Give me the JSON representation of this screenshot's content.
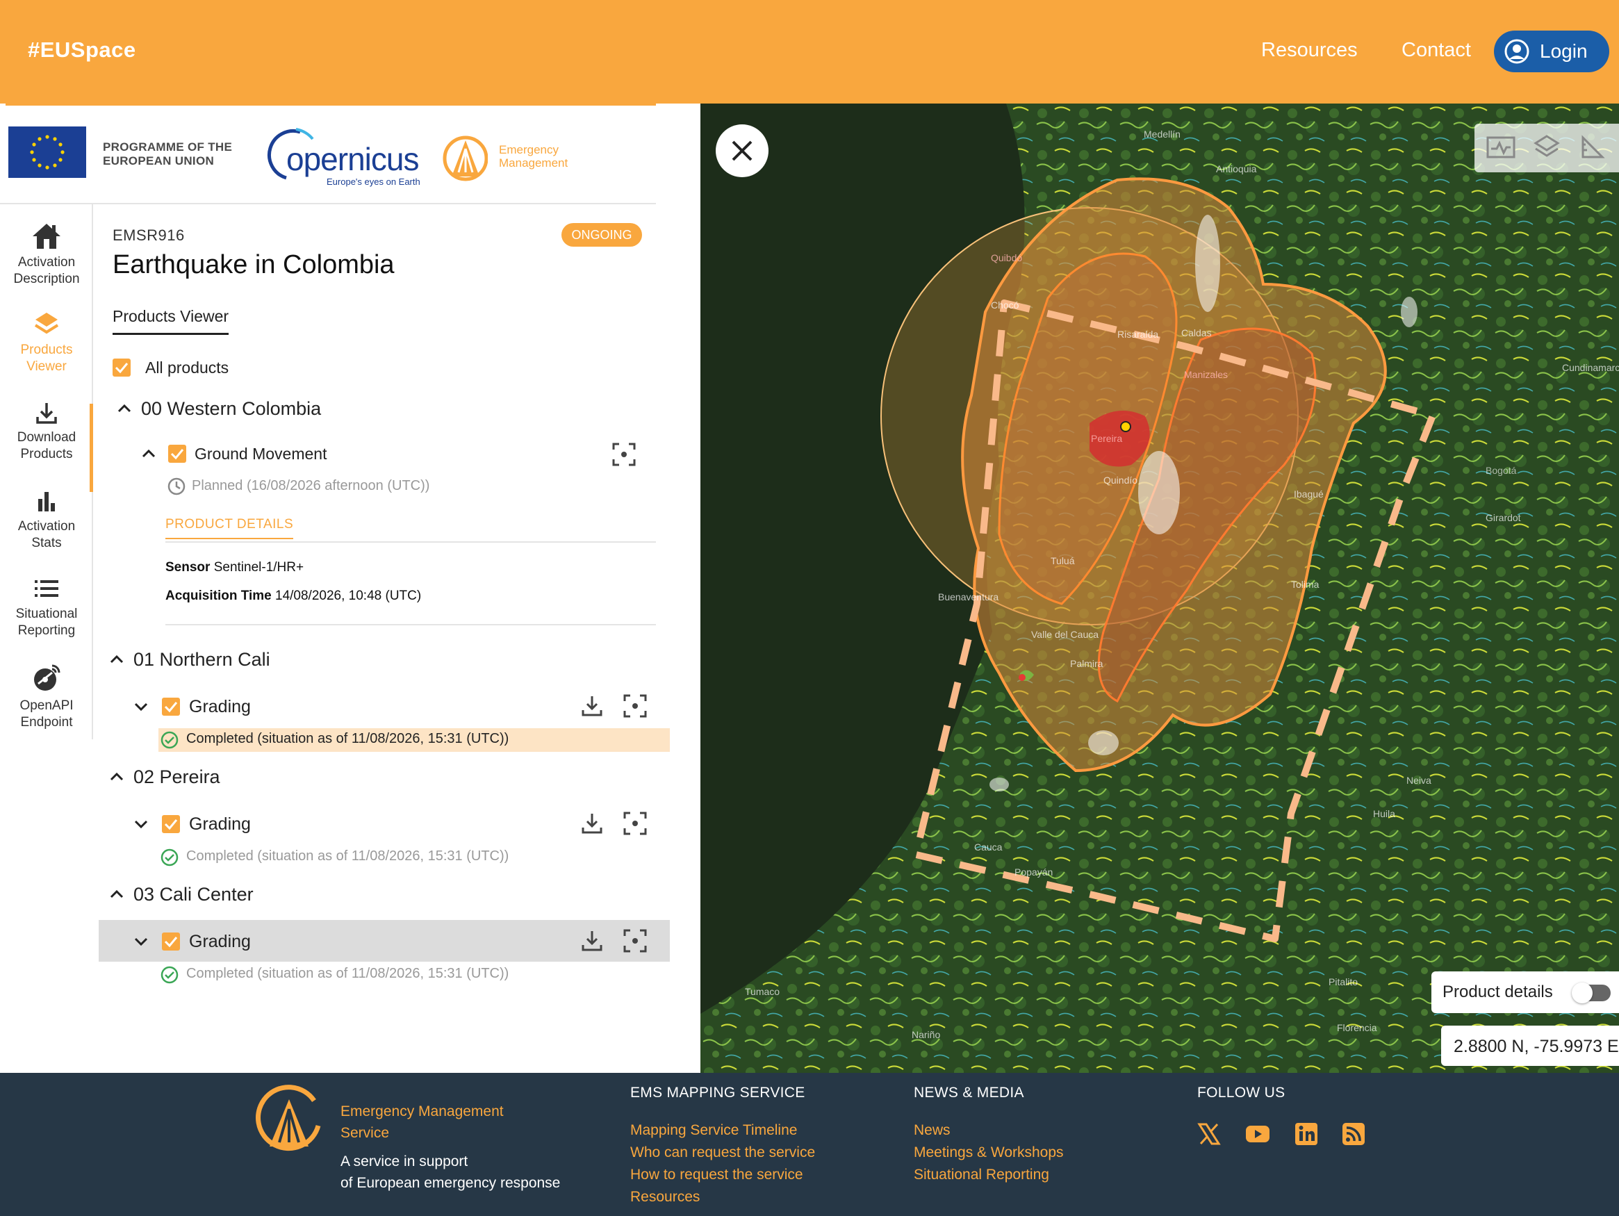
{
  "header": {
    "brand": "#EUSpace",
    "nav": {
      "resources": "Resources",
      "contact": "Contact"
    },
    "login_label": "Login"
  },
  "logos": {
    "eu_programme": [
      "PROGRAMME OF THE",
      "EUROPEAN UNION"
    ],
    "copernicus_word": "opernicus",
    "copernicus_tagline": "Europe's eyes on Earth",
    "em_lines": [
      "Emergency",
      "Management"
    ]
  },
  "sidebar": {
    "items": [
      {
        "lines": [
          "Activation",
          "Description"
        ],
        "icon": "house-icon"
      },
      {
        "lines": [
          "Products",
          "Viewer"
        ],
        "icon": "layers-icon",
        "active": true
      },
      {
        "lines": [
          "Download",
          "Products"
        ],
        "icon": "download-icon"
      },
      {
        "lines": [
          "Activation",
          "Stats"
        ],
        "icon": "bar-chart-icon"
      },
      {
        "lines": [
          "Situational",
          "Reporting"
        ],
        "icon": "list-icon"
      },
      {
        "lines": [
          "OpenAPI",
          "Endpoint"
        ],
        "icon": "satellite-dish-icon"
      }
    ]
  },
  "activation": {
    "code": "EMSR916",
    "status": "ONGOING",
    "title": "Earthquake in Colombia",
    "tab": "Products Viewer"
  },
  "products": {
    "all_label": "All products",
    "aois": [
      {
        "name": "00 Western Colombia",
        "product": {
          "type": "Ground Movement",
          "status": "Planned (16/08/2026 afternoon (UTC))",
          "details_tab": "PRODUCT DETAILS",
          "sensor_label": "Sensor",
          "sensor_value": "Sentinel-1/HR+",
          "acq_label": "Acquisition Time",
          "acq_value": "14/08/2026, 10:48 (UTC)"
        }
      },
      {
        "name": "01 Northern Cali",
        "product": {
          "type": "Grading",
          "status": "Completed (situation as of 11/08/2026, 15:31 (UTC))"
        }
      },
      {
        "name": "02 Pereira",
        "product": {
          "type": "Grading",
          "status": "Completed (situation as of 11/08/2026, 15:31 (UTC))"
        }
      },
      {
        "name": "03 Cali Center",
        "product": {
          "type": "Grading",
          "status": "Completed (situation as of 11/08/2026, 15:31 (UTC))"
        }
      }
    ]
  },
  "map": {
    "product_details_label": "Product details",
    "coordinates": "2.8800 N, -75.9973 E",
    "place_labels": [
      "Medellín",
      "Antioquia",
      "Quibdó",
      "Chocó",
      "Risaralda",
      "Caldas",
      "Manizales",
      "Cundinamarca",
      "Pereira",
      "Quindío",
      "Ibagué",
      "Girardot",
      "Tolima",
      "Buenaventura",
      "Valle del Cauca",
      "Tuluá",
      "Palmira",
      "Neiva",
      "Huila",
      "Cauca",
      "Popayán",
      "Pitalito",
      "Tumaco",
      "Nariño",
      "Florencia",
      "Bogotá"
    ]
  },
  "footer": {
    "service_lines": [
      "Emergency Management",
      "Service"
    ],
    "support_lines": [
      "A service in support",
      "of European emergency response"
    ],
    "col1": {
      "heading": "EMS MAPPING SERVICE",
      "links": [
        "Mapping Service Timeline",
        "Who can request the service",
        "How to request the service",
        "Resources"
      ]
    },
    "col2": {
      "heading": "NEWS & MEDIA",
      "links": [
        "News",
        "Meetings & Workshops",
        "Situational Reporting"
      ]
    },
    "col3": {
      "heading": "FOLLOW US",
      "icons": [
        "x-icon",
        "youtube-icon",
        "linkedin-icon",
        "rss-icon"
      ]
    }
  },
  "colors": {
    "accent": "#f9a73e",
    "blue": "#1b5ea8",
    "footer_bg": "#263746",
    "completed_green": "#3aa655"
  }
}
